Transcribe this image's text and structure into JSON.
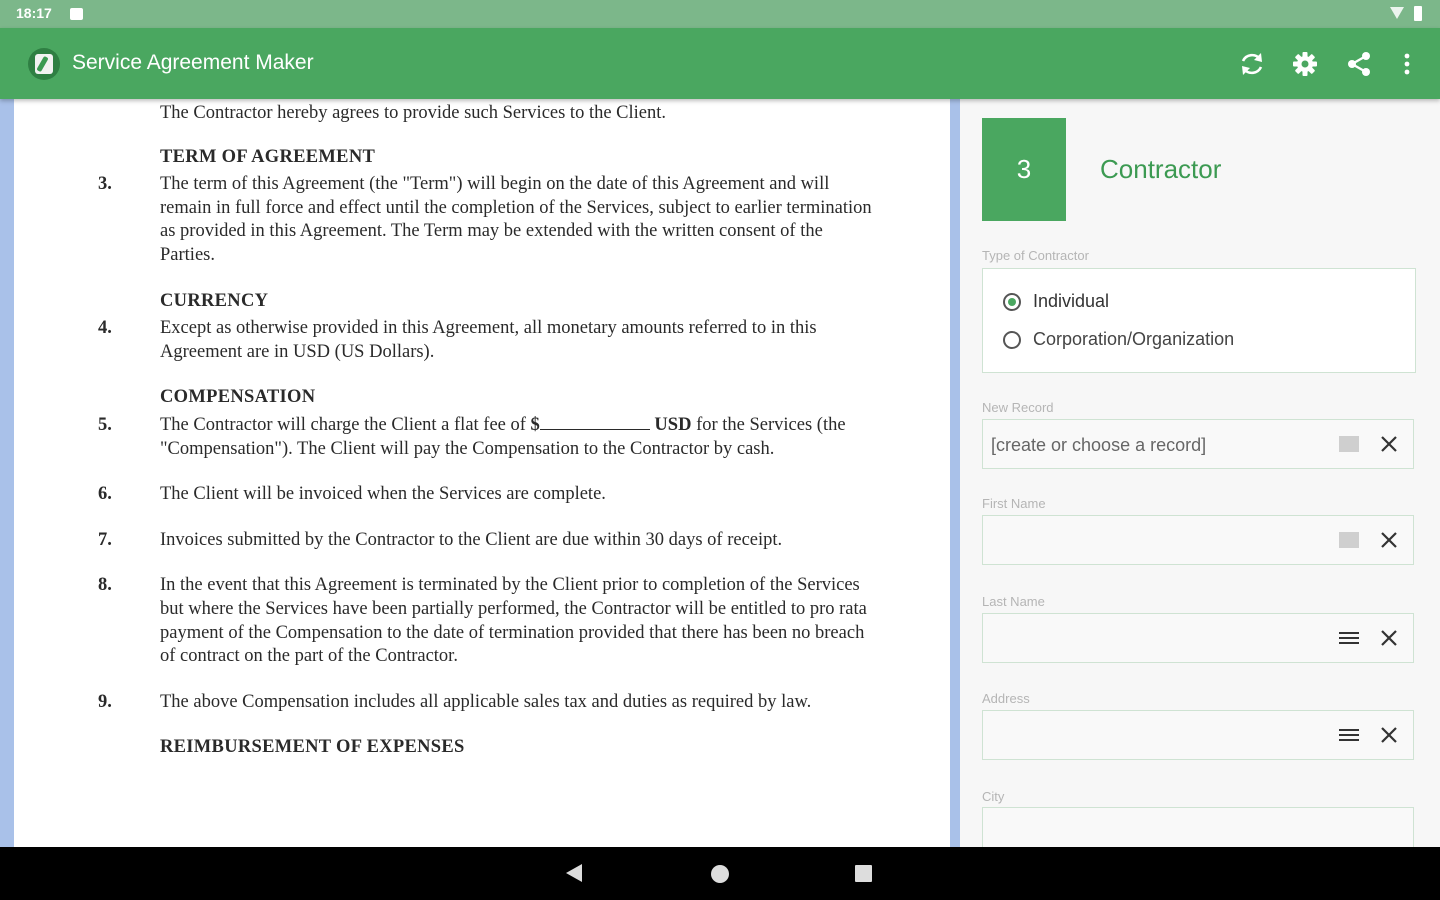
{
  "status_bar": {
    "time": "18:17"
  },
  "app_bar": {
    "title": "Service Agreement Maker",
    "icons": [
      "refresh-icon",
      "settings-gear-icon",
      "share-icon",
      "more-vert-icon"
    ]
  },
  "document": {
    "first_line": "The Contractor hereby agrees to provide such Services to the Client.",
    "sections": [
      {
        "heading": "TERM OF AGREEMENT",
        "paragraphs": [
          {
            "num": "3.",
            "text": "The term of this Agreement (the \"Term\") will begin on the date of this Agreement and will remain in full force and effect until the completion of the Services, subject to earlier termination as provided in this Agreement. The Term may be extended with the written consent of the Parties."
          }
        ]
      },
      {
        "heading": "CURRENCY",
        "paragraphs": [
          {
            "num": "4.",
            "text": "Except as otherwise provided in this Agreement, all monetary amounts referred to in this Agreement are in USD (US Dollars)."
          }
        ]
      },
      {
        "heading": "COMPENSATION",
        "paragraphs": [
          {
            "num": "5.",
            "text_before": "The Contractor will charge the Client a flat fee of ",
            "fee_prefix": "$",
            "fee_suffix": "USD",
            "text_after": " for the Services (the \"Compensation\"). The Client will pay the Compensation to the Contractor by cash."
          },
          {
            "num": "6.",
            "text": "The Client will be invoiced when the Services are complete."
          },
          {
            "num": "7.",
            "text": "Invoices submitted by the Contractor to the Client are due within 30 days of receipt."
          },
          {
            "num": "8.",
            "text": "In the event that this Agreement is terminated by the Client prior to completion of the Services but where the Services have been partially performed, the Contractor will be entitled to pro rata payment of the Compensation to the date of termination provided that there has been no breach of contract on the part of the Contractor."
          },
          {
            "num": "9.",
            "text": "The above Compensation includes all applicable sales tax and duties as required by law."
          }
        ]
      },
      {
        "heading": "REIMBURSEMENT OF EXPENSES"
      }
    ]
  },
  "panel": {
    "step_number": "3",
    "step_title": "Contractor",
    "type_label": "Type of Contractor",
    "type_options": [
      "Individual",
      "Corporation/Organization"
    ],
    "type_selected": "Individual",
    "fields": [
      {
        "label": "New Record",
        "placeholder": "[create or choose a record]",
        "value": ""
      },
      {
        "label": "First Name",
        "placeholder": "",
        "value": ""
      },
      {
        "label": "Last Name",
        "placeholder": "",
        "value": ""
      },
      {
        "label": "Address",
        "placeholder": "",
        "value": ""
      },
      {
        "label": "City",
        "placeholder": "",
        "value": ""
      }
    ]
  },
  "colors": {
    "primary": "#4aa760",
    "status_bar": "#7cb78a",
    "accent_text": "#3c9a52",
    "doc_margin": "#a9c1e9"
  },
  "nav_bar": {
    "icons": [
      "back-icon",
      "home-icon",
      "recent-apps-icon"
    ]
  }
}
